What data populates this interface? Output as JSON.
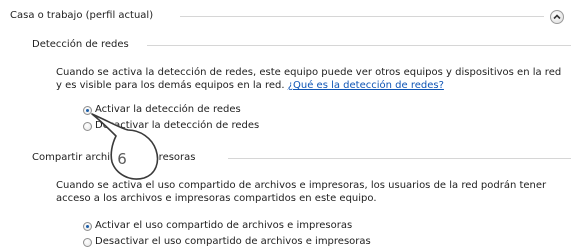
{
  "section": {
    "title": "Casa o trabajo (perfil actual)",
    "collapse_icon": "chevron-up-icon"
  },
  "network_discovery": {
    "title": "Detección de redes",
    "description_line1": "Cuando se activa la detección de redes, este equipo puede ver otros equipos y dispositivos en la red",
    "description_line2": "y es visible para los demás equipos en la red.",
    "help_link": "¿Qué es la detección de redes?",
    "options": [
      {
        "label": "Activar la detección de redes",
        "checked": true
      },
      {
        "label": "Desactivar la detección de redes",
        "checked": false
      }
    ]
  },
  "file_sharing": {
    "title": "Compartir archivos e impresoras",
    "description_line1": "Cuando se activa el uso compartido de archivos e impresoras, los usuarios de la red podrán tener",
    "description_line2": "acceso a los archivos e impresoras compartidos en este equipo.",
    "options": [
      {
        "label": "Activar el uso compartido de archivos e impresoras",
        "checked": true
      },
      {
        "label": "Desactivar el uso compartido de archivos e impresoras",
        "checked": false
      }
    ]
  },
  "annotation": {
    "callout_number": "6",
    "color": "#3a3a3a"
  }
}
